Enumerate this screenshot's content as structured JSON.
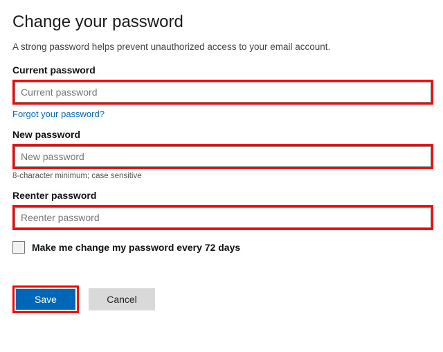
{
  "title": "Change your password",
  "subtitle": "A strong password helps prevent unauthorized access to your email account.",
  "current": {
    "label": "Current password",
    "placeholder": "Current password"
  },
  "forgot_link": "Forgot your password?",
  "new": {
    "label": "New password",
    "placeholder": "New password",
    "hint": "8-character minimum; case sensitive"
  },
  "reenter": {
    "label": "Reenter password",
    "placeholder": "Reenter password"
  },
  "periodic_change_label": "Make me change my password every 72 days",
  "save_label": "Save",
  "cancel_label": "Cancel",
  "colors": {
    "highlight": "#ff0000",
    "primary": "#0067b8"
  }
}
